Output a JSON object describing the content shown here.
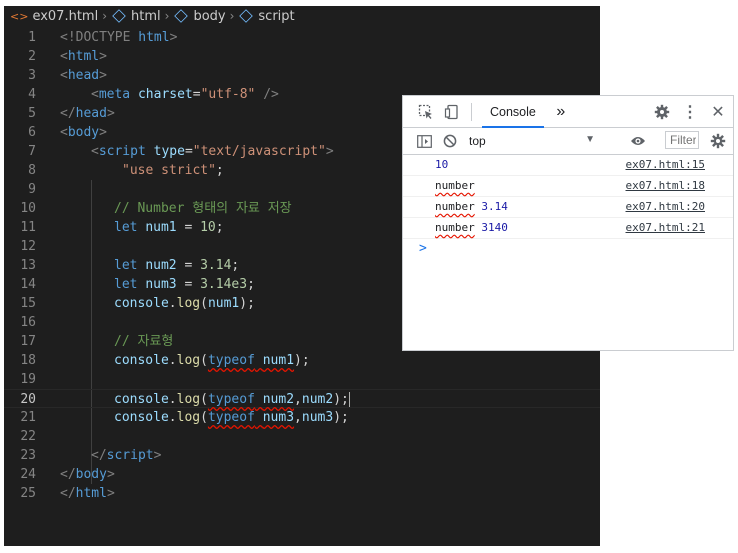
{
  "breadcrumb": {
    "file_icon": "<>",
    "file": "ex07.html",
    "items": [
      "html",
      "body",
      "script"
    ]
  },
  "editor": {
    "line_numbers": [
      "1",
      "2",
      "3",
      "4",
      "5",
      "6",
      "7",
      "8",
      "9",
      "10",
      "11",
      "12",
      "13",
      "14",
      "15",
      "16",
      "17",
      "18",
      "19",
      "20",
      "21",
      "22",
      "23",
      "24",
      "25"
    ],
    "tokens": {
      "doctype_open": "<!DOCTYPE ",
      "doctype_name": "html",
      "gt": ">",
      "lt": "<",
      "lt_slash": "</",
      "self_close": " />",
      "html": "html",
      "head": "head",
      "body": "body",
      "meta": "meta",
      "script": "script",
      "charset_attr": "charset",
      "eq": "=",
      "utf8": "\"utf-8\"",
      "type_attr": "type",
      "type_val": "\"text/javascript\"",
      "use_strict": "\"use strict\"",
      "semicolon": ";",
      "comment1": "// Number 형태의 자료 저장",
      "comment2": "// 자료형",
      "let": "let",
      "num1": "num1",
      "num2": "num2",
      "num3": "num3",
      "assign": " = ",
      "v10": "10",
      "v314": "3.14",
      "v314e3": "3.14e3",
      "console": "console",
      "dot": ".",
      "log": "log",
      "lparen": "(",
      "rparen": ")",
      "typeof": "typeof",
      "comma": ",",
      "end": ");"
    }
  },
  "devtools": {
    "tab_label": "Console",
    "more_tabs": "»",
    "context": "top",
    "filter_placeholder": "Filter",
    "messages": [
      {
        "text": "10",
        "type": "",
        "source": "ex07.html:15"
      },
      {
        "text": "",
        "type": "number",
        "source": "ex07.html:18"
      },
      {
        "text": "3.14",
        "type": "number",
        "source": "ex07.html:20"
      },
      {
        "text": "3140",
        "type": "number",
        "source": "ex07.html:21"
      }
    ],
    "prompt": ">"
  }
}
